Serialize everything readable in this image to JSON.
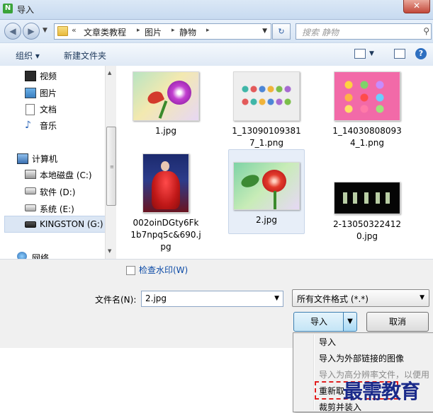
{
  "window": {
    "title": "导入",
    "close_label": "✕"
  },
  "nav": {
    "back_icon": "arrow-left-icon",
    "forward_icon": "arrow-right-icon",
    "breadcrumb_prefix": "«",
    "breadcrumbs": [
      "文章类教程",
      "图片",
      "静物"
    ],
    "search_placeholder": "搜索 静物"
  },
  "toolbar": {
    "organize_label": "组织 ▾",
    "new_folder_label": "新建文件夹"
  },
  "sidebar": {
    "items": [
      {
        "label": "视频",
        "icon": "video-icon"
      },
      {
        "label": "图片",
        "icon": "image-icon"
      },
      {
        "label": "文档",
        "icon": "document-icon"
      },
      {
        "label": "音乐",
        "icon": "music-icon"
      },
      {
        "label": "计算机",
        "icon": "computer-icon"
      },
      {
        "label": "本地磁盘 (C:)",
        "icon": "disk-icon"
      },
      {
        "label": "软件 (D:)",
        "icon": "drive-icon"
      },
      {
        "label": "系统 (E:)",
        "icon": "drive-icon"
      },
      {
        "label": "KINGSTON (G:)",
        "icon": "usb-drive-icon"
      },
      {
        "label": "网络",
        "icon": "network-icon"
      }
    ]
  },
  "files": [
    {
      "name": "1.jpg",
      "kind": "flower-purple"
    },
    {
      "name": "1_130901093817_1.png",
      "kind": "icons-grid"
    },
    {
      "name": "1_140308080934_1.png",
      "kind": "icons-pink"
    },
    {
      "name": "002oinDGty6Fk1b7npq5c&690.jpg",
      "kind": "portrait-red"
    },
    {
      "name": "2.jpg",
      "kind": "flower-red",
      "selected": true
    },
    {
      "name": "2-130503224120.jpg",
      "kind": "black-calligraphy"
    }
  ],
  "bottom": {
    "checkbox_label": "检查水印(W)",
    "filename_label": "文件名(N):",
    "filename_value": "2.jpg",
    "filetype_value": "所有文件格式 (*.*)",
    "import_label": "导入",
    "cancel_label": "取消"
  },
  "menu": {
    "items": [
      {
        "label": "导入",
        "enabled": true
      },
      {
        "label": "导入为外部链接的图像",
        "enabled": true
      },
      {
        "label": "导入为高分辨率文件，以便用",
        "enabled": false
      },
      {
        "label": "重新取",
        "enabled": true
      },
      {
        "label": "裁剪并装入",
        "enabled": true
      }
    ]
  },
  "watermark_text": "最需教育"
}
